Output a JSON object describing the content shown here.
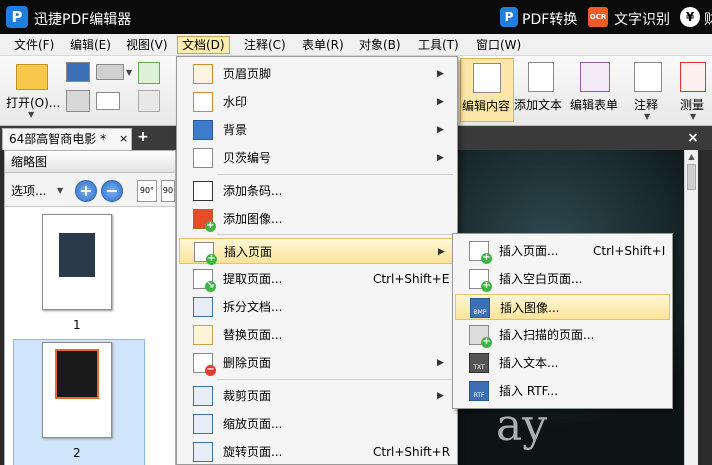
{
  "title_bar": {
    "logo_letter": "P",
    "app_title": "迅捷PDF编辑器",
    "pdf_convert": "PDF转换",
    "ocr_icon_text": "OCR",
    "ocr": "文字识别",
    "yen_symbol": "¥",
    "account_partial": "财"
  },
  "menubar": [
    {
      "label": "文件(F)"
    },
    {
      "label": "编辑(E)"
    },
    {
      "label": "视图(V)"
    },
    {
      "label": "文档(D)",
      "active": true
    },
    {
      "label": "注释(C)"
    },
    {
      "label": "表单(R)"
    },
    {
      "label": "对象(B)"
    },
    {
      "label": "工具(T)"
    },
    {
      "label": "窗口(W)"
    }
  ],
  "toolbar": {
    "open_label": "打开(O)...",
    "edit_content": "编辑内容",
    "add_text": "添加文本",
    "edit_form": "编辑表单",
    "annotate": "注释",
    "measure": "测量"
  },
  "doc_tab": {
    "label": "64部高智商电影 *",
    "close": "×",
    "new_tab": "+",
    "viewer_close": "×"
  },
  "thumbnail_panel": {
    "title": "缩略图",
    "options": "选项...",
    "zoom_in": "+",
    "zoom_out": "−",
    "rotate_ccw": "90°",
    "rotate_cw": "90",
    "pages": [
      {
        "number": "1"
      },
      {
        "number": "2"
      }
    ]
  },
  "viewer": {
    "page_text": "ay"
  },
  "document_menu": [
    {
      "label": "页眉页脚",
      "icon": "header-footer-icon",
      "submenu": true
    },
    {
      "label": "水印",
      "icon": "watermark-icon",
      "submenu": true
    },
    {
      "label": "背景",
      "icon": "background-icon",
      "submenu": true
    },
    {
      "label": "贝茨编号",
      "icon": "bates-number-icon",
      "submenu": true
    },
    {
      "label": "添加条码...",
      "icon": "barcode-icon"
    },
    {
      "label": "添加图像...",
      "icon": "image-icon"
    },
    {
      "label": "插入页面",
      "icon": "insert-page-icon",
      "submenu": true,
      "highlighted": true
    },
    {
      "label": "提取页面...",
      "icon": "extract-page-icon",
      "shortcut": "Ctrl+Shift+E"
    },
    {
      "label": "拆分文档...",
      "icon": "split-document-icon"
    },
    {
      "label": "替换页面...",
      "icon": "replace-page-icon"
    },
    {
      "label": "删除页面",
      "icon": "delete-page-icon",
      "submenu": true
    },
    {
      "label": "裁剪页面",
      "icon": "crop-page-icon",
      "submenu": true
    },
    {
      "label": "缩放页面...",
      "icon": "resize-page-icon"
    },
    {
      "label": "旋转页面...",
      "icon": "rotate-page-icon",
      "shortcut": "Ctrl+Shift+R"
    }
  ],
  "insert_submenu": [
    {
      "label": "插入页面...",
      "icon": "insert-page-icon",
      "shortcut": "Ctrl+Shift+I"
    },
    {
      "label": "插入空白页面...",
      "icon": "insert-blank-page-icon"
    },
    {
      "label": "插入图像...",
      "icon": "insert-image-bmp-icon",
      "highlighted": true,
      "icon_text": "BMP"
    },
    {
      "label": "插入扫描的页面...",
      "icon": "insert-scan-icon"
    },
    {
      "label": "插入文本...",
      "icon": "insert-text-icon",
      "icon_text": "TXT"
    },
    {
      "label": "插入 RTF...",
      "icon": "insert-rtf-icon",
      "icon_text": "RTF"
    }
  ],
  "colors": {
    "menu_highlight": "#fbe49a",
    "title_bg": "#0b0b0b",
    "brand_blue": "#1e7fe0",
    "ocr_orange": "#f05a28"
  }
}
